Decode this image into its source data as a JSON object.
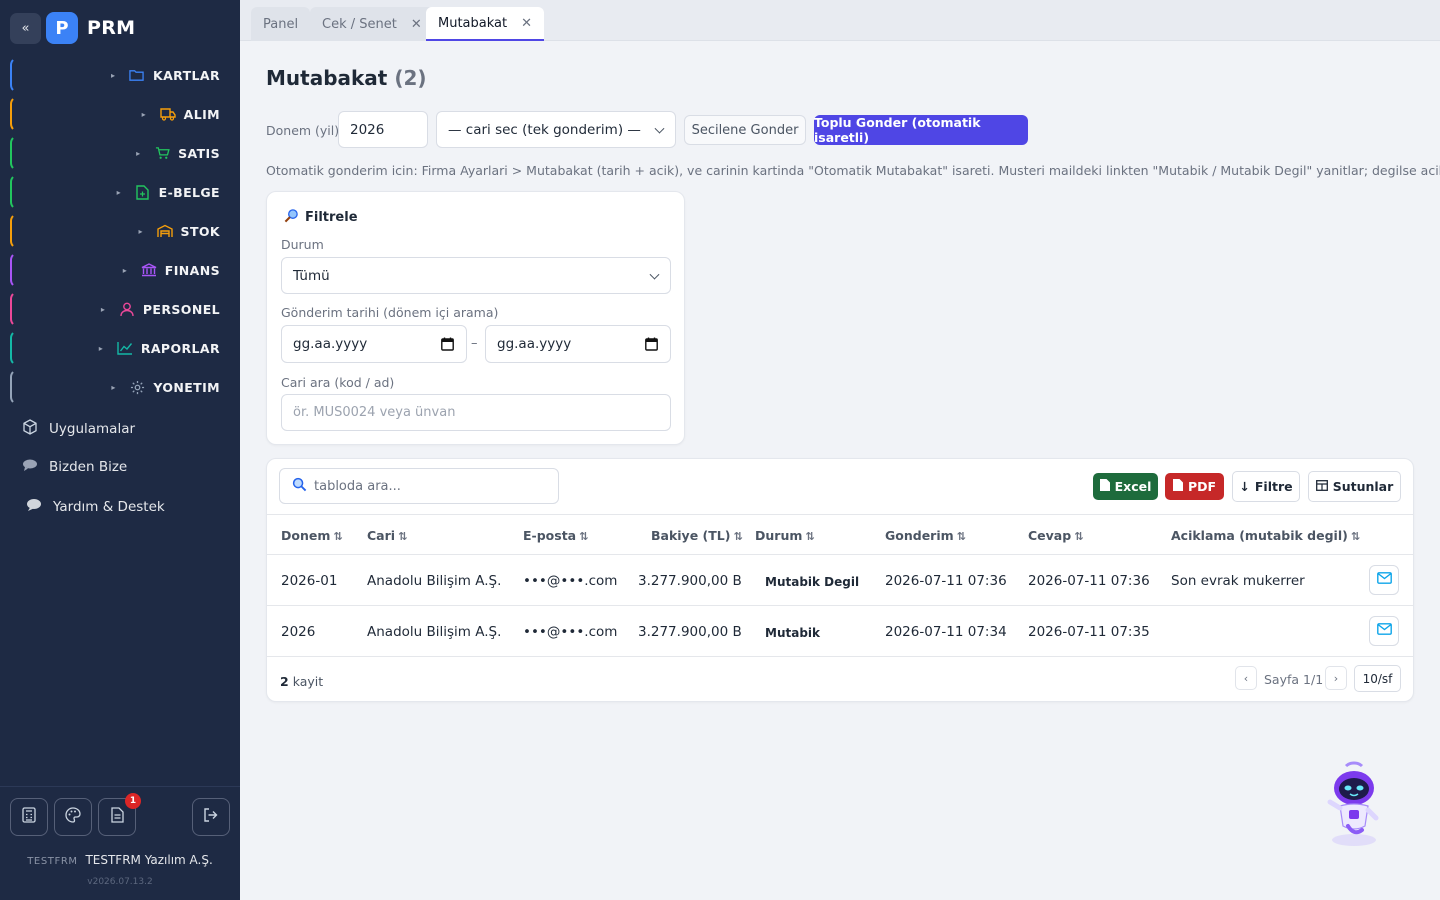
{
  "sidebar": {
    "collapse_icon": "«",
    "logo_letter": "P",
    "app_name": "PRM",
    "nav": [
      {
        "label": "KARTLAR",
        "icon": "folder-icon",
        "color": "#3b82f6"
      },
      {
        "label": "ALIM",
        "icon": "truck-icon",
        "color": "#f59e0b"
      },
      {
        "label": "SATIS",
        "icon": "cart-icon",
        "color": "#22c55e"
      },
      {
        "label": "E-BELGE",
        "icon": "document-icon",
        "color": "#22c55e"
      },
      {
        "label": "STOK",
        "icon": "warehouse-icon",
        "color": "#f59e0b"
      },
      {
        "label": "FINANS",
        "icon": "bank-icon",
        "color": "#a855f7"
      },
      {
        "label": "PERSONEL",
        "icon": "user-icon",
        "color": "#ec4899"
      },
      {
        "label": "RAPORLAR",
        "icon": "chart-icon",
        "color": "#14b8a6"
      },
      {
        "label": "YONETIM",
        "icon": "gear-icon",
        "color": "#94a3b8"
      }
    ],
    "links": [
      {
        "label": "Uygulamalar",
        "icon": "cube-icon"
      },
      {
        "label": "Bizden Bize",
        "icon": "chat-icon"
      },
      {
        "label": "Yardım & Destek",
        "icon": "speech-icon"
      }
    ],
    "notif_count": "1",
    "company_code": "TESTFRM",
    "company_name": "TESTFRM Yazılım A.Ş.",
    "version": "v2026.07.13.2"
  },
  "tabs": [
    {
      "label": "Panel",
      "closable": false,
      "active": false
    },
    {
      "label": "Cek / Senet",
      "closable": true,
      "active": false
    },
    {
      "label": "Mutabakat",
      "closable": true,
      "active": true
    }
  ],
  "page": {
    "title": "Mutabakat",
    "count": "(2)",
    "donem_label": "Donem (yil)",
    "donem_value": "2026",
    "cari_select": "— cari sec (tek gonderim) —",
    "send_selected": "Secilene Gonder",
    "send_bulk": "Toplu Gonder (otomatik isaretli)",
    "info": "Otomatik gonderim icin: Firma Ayarlari > Mutabakat (tarih + acik), ve carinin kartinda \"Otomatik Mutabakat\" isareti. Musteri maildeki linkten \"Mutabik / Mutabik Degil\" yanitlar; degilse aciklama ister."
  },
  "filter": {
    "title": "Filtrele",
    "durum_label": "Durum",
    "durum_value": "Tümü",
    "date_label": "Gönderim tarihi (dönem içi arama)",
    "date_from": "gg.aa.yyyy",
    "date_sep": "–",
    "date_to": "gg.aa.yyyy",
    "cari_label": "Cari ara (kod / ad)",
    "cari_placeholder": "ör. MUS0024 veya ünvan"
  },
  "table": {
    "search_placeholder": "tabloda ara...",
    "btn_excel": "Excel",
    "btn_pdf": "PDF",
    "btn_filter": "Filtre",
    "btn_columns": "Sutunlar",
    "columns": [
      "Donem",
      "Cari",
      "E-posta",
      "Bakiye (TL)",
      "Durum",
      "Gonderim",
      "Cevap",
      "Aciklama (mutabik degil)"
    ],
    "rows": [
      {
        "donem": "2026-01",
        "cari": "Anadolu Bilişim A.Ş.",
        "eposta": "•••@•••.com",
        "bakiye": "3.277.900,00 B",
        "durum": "Mutabik Degil",
        "gonderim": "2026-07-11 07:36",
        "cevap": "2026-07-11 07:36",
        "aciklama": "Son evrak mukerrer"
      },
      {
        "donem": "2026",
        "cari": "Anadolu Bilişim A.Ş.",
        "eposta": "•••@•••.com",
        "bakiye": "3.277.900,00 B",
        "durum": "Mutabik",
        "gonderim": "2026-07-11 07:34",
        "cevap": "2026-07-11 07:35",
        "aciklama": ""
      }
    ],
    "count_num": "2",
    "count_label": "kayit",
    "page_text": "Sayfa 1/1",
    "page_size": "10/sf"
  },
  "colors": {
    "accent": "#4f46e5",
    "sidebar": "#1e2a44",
    "excel": "#1e6b3c",
    "pdf": "#c62828"
  }
}
